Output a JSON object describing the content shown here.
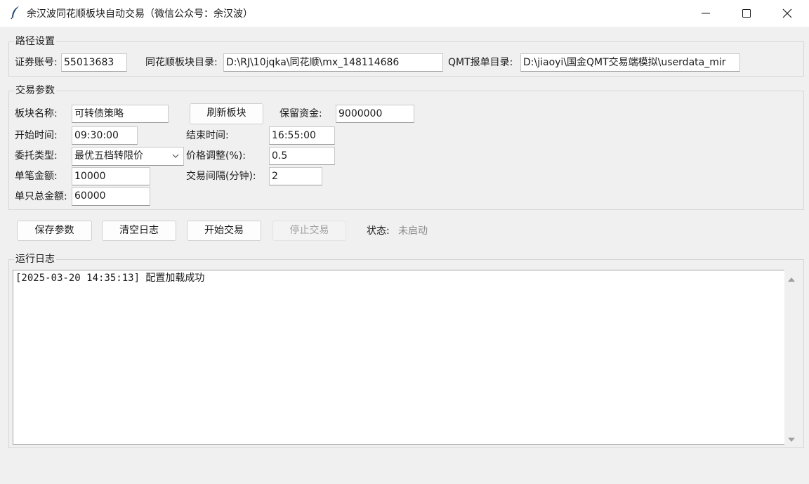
{
  "window": {
    "title": "余汉波同花顺板块自动交易（微信公众号：余汉波）"
  },
  "path_settings": {
    "group_label": "路径设置",
    "account_label": "证券账号:",
    "account_value": "55013683",
    "ths_dir_label": "同花顺板块目录:",
    "ths_dir_value": "D:\\RJ\\10jqka\\同花顺\\mx_148114686",
    "qmt_dir_label": "QMT报单目录:",
    "qmt_dir_value": "D:\\jiaoyi\\国金QMT交易端模拟\\userdata_mir"
  },
  "trade_params": {
    "group_label": "交易参数",
    "block_name_label": "板块名称:",
    "block_name_value": "可转债策略",
    "refresh_button": "刷新板块",
    "reserve_funds_label": "保留资金:",
    "reserve_funds_value": "9000000",
    "start_time_label": "开始时间:",
    "start_time_value": "09:30:00",
    "end_time_label": "结束时间:",
    "end_time_value": "16:55:00",
    "order_type_label": "委托类型:",
    "order_type_value": "最优五档转限价",
    "price_adjust_label": "价格调整(%):",
    "price_adjust_value": "0.5",
    "single_amount_label": "单笔金额:",
    "single_amount_value": "10000",
    "interval_label": "交易间隔(分钟):",
    "interval_value": "2",
    "total_amount_label": "单只总金额:",
    "total_amount_value": "60000"
  },
  "actions": {
    "save_button": "保存参数",
    "clear_log_button": "清空日志",
    "start_button": "开始交易",
    "stop_button": "停止交易",
    "status_label": "状态:",
    "status_value": "未启动"
  },
  "log": {
    "group_label": "运行日志",
    "lines": "[2025-03-20 14:35:13] 配置加载成功"
  },
  "colors": {
    "background": "#f0f0f0",
    "status_text": "#8a8a8a",
    "disabled_text": "#a0a0a0"
  }
}
